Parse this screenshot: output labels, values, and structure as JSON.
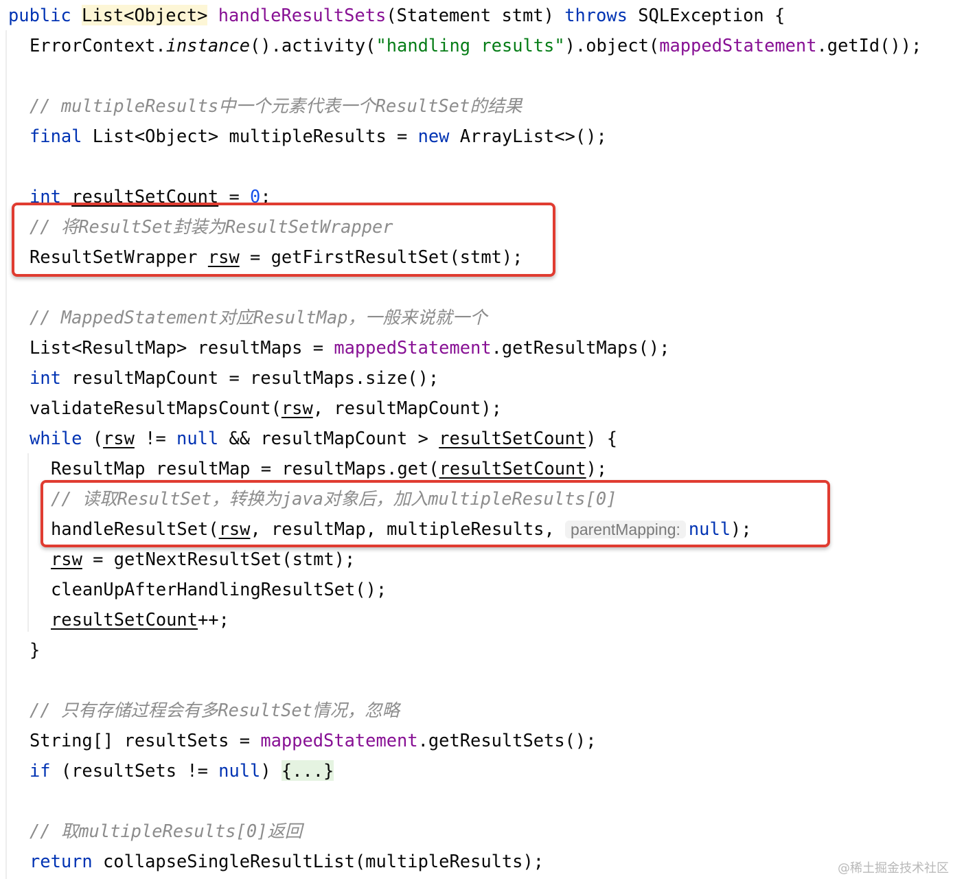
{
  "watermark": "@稀土掘金技术社区",
  "inlay_hint": "parentMapping:",
  "code_lines": [
    [
      {
        "text": "public ",
        "k": "kw"
      },
      {
        "text": "List<Object>",
        "k": "plain hl"
      },
      {
        "text": " "
      },
      {
        "text": "handleResultSets",
        "k": "field"
      },
      {
        "text": "(Statement stmt) "
      },
      {
        "text": "throws",
        "k": "kw"
      },
      {
        "text": " SQLException {"
      }
    ],
    [
      {
        "text": "ErrorContext."
      },
      {
        "text": "instance",
        "k": "italic"
      },
      {
        "text": "().activity("
      },
      {
        "text": "\"handling results\"",
        "k": "str"
      },
      {
        "text": ").object("
      },
      {
        "text": "mappedStatement",
        "k": "field"
      },
      {
        "text": ".getId());"
      }
    ],
    [],
    [
      {
        "text": "// multipleResults中一个元素代表一个ResultSet的结果",
        "k": "cm"
      }
    ],
    [
      {
        "text": "final",
        "k": "kw"
      },
      {
        "text": " List<Object> multipleResults = "
      },
      {
        "text": "new",
        "k": "kw"
      },
      {
        "text": " ArrayList<>();"
      }
    ],
    [],
    [
      {
        "text": "int",
        "k": "kw"
      },
      {
        "text": " "
      },
      {
        "text": "resultSetCount",
        "k": "uline"
      },
      {
        "text": " = "
      },
      {
        "text": "0",
        "k": "num"
      },
      {
        "text": ";"
      }
    ],
    [
      {
        "text": "// 将ResultSet封装为ResultSetWrapper",
        "k": "cm"
      }
    ],
    [
      {
        "text": "ResultSetWrapper "
      },
      {
        "text": "rsw",
        "k": "uline"
      },
      {
        "text": " = getFirstResultSet(stmt);"
      }
    ],
    [],
    [
      {
        "text": "// MappedStatement对应ResultMap，一般来说就一个",
        "k": "cm"
      }
    ],
    [
      {
        "text": "List<ResultMap> resultMaps = "
      },
      {
        "text": "mappedStatement",
        "k": "field"
      },
      {
        "text": ".getResultMaps();"
      }
    ],
    [
      {
        "text": "int",
        "k": "kw"
      },
      {
        "text": " resultMapCount = resultMaps.size();"
      }
    ],
    [
      {
        "text": "validateResultMapsCount("
      },
      {
        "text": "rsw",
        "k": "uline"
      },
      {
        "text": ", resultMapCount);"
      }
    ],
    [
      {
        "text": "while",
        "k": "kw"
      },
      {
        "text": " ("
      },
      {
        "text": "rsw",
        "k": "uline"
      },
      {
        "text": " != "
      },
      {
        "text": "null",
        "k": "kw"
      },
      {
        "text": " && resultMapCount > "
      },
      {
        "text": "resultSetCount",
        "k": "uline"
      },
      {
        "text": ") {"
      }
    ],
    [
      {
        "text": "ResultMap resultMap = resultMaps.get("
      },
      {
        "text": "resultSetCount",
        "k": "uline"
      },
      {
        "text": ");"
      }
    ],
    [
      {
        "text": "// 读取ResultSet，转换为java对象后，加入multipleResults[0]",
        "k": "cm"
      }
    ],
    [
      {
        "text": "handleResultSet("
      },
      {
        "text": "rsw",
        "k": "uline"
      },
      {
        "text": ", resultMap, multipleResults, "
      },
      {
        "text": "@inlay",
        "k": "inlay"
      },
      {
        "text": "null",
        "k": "kw"
      },
      {
        "text": ");"
      }
    ],
    [
      {
        "text": "rsw",
        "k": "uline"
      },
      {
        "text": " = getNextResultSet(stmt);"
      }
    ],
    [
      {
        "text": "cleanUpAfterHandlingResultSet();"
      }
    ],
    [
      {
        "text": "resultSetCount",
        "k": "uline"
      },
      {
        "text": "++;"
      }
    ],
    [
      {
        "text": "}"
      }
    ],
    [],
    [
      {
        "text": "// 只有存储过程会有多ResultSet情况，忽略",
        "k": "cm"
      }
    ],
    [
      {
        "text": "String[] resultSets = "
      },
      {
        "text": "mappedStatement",
        "k": "field"
      },
      {
        "text": ".getResultSets();"
      }
    ],
    [
      {
        "text": "if",
        "k": "kw"
      },
      {
        "text": " (resultSets != "
      },
      {
        "text": "null",
        "k": "kw"
      },
      {
        "text": ") "
      },
      {
        "text": "{...}",
        "k": "fold"
      }
    ],
    [],
    [
      {
        "text": "// 取multipleResults[0]返回",
        "k": "cm"
      }
    ],
    [
      {
        "text": "return",
        "k": "kw"
      },
      {
        "text": " collapseSingleResultList(multipleResults);"
      }
    ]
  ]
}
